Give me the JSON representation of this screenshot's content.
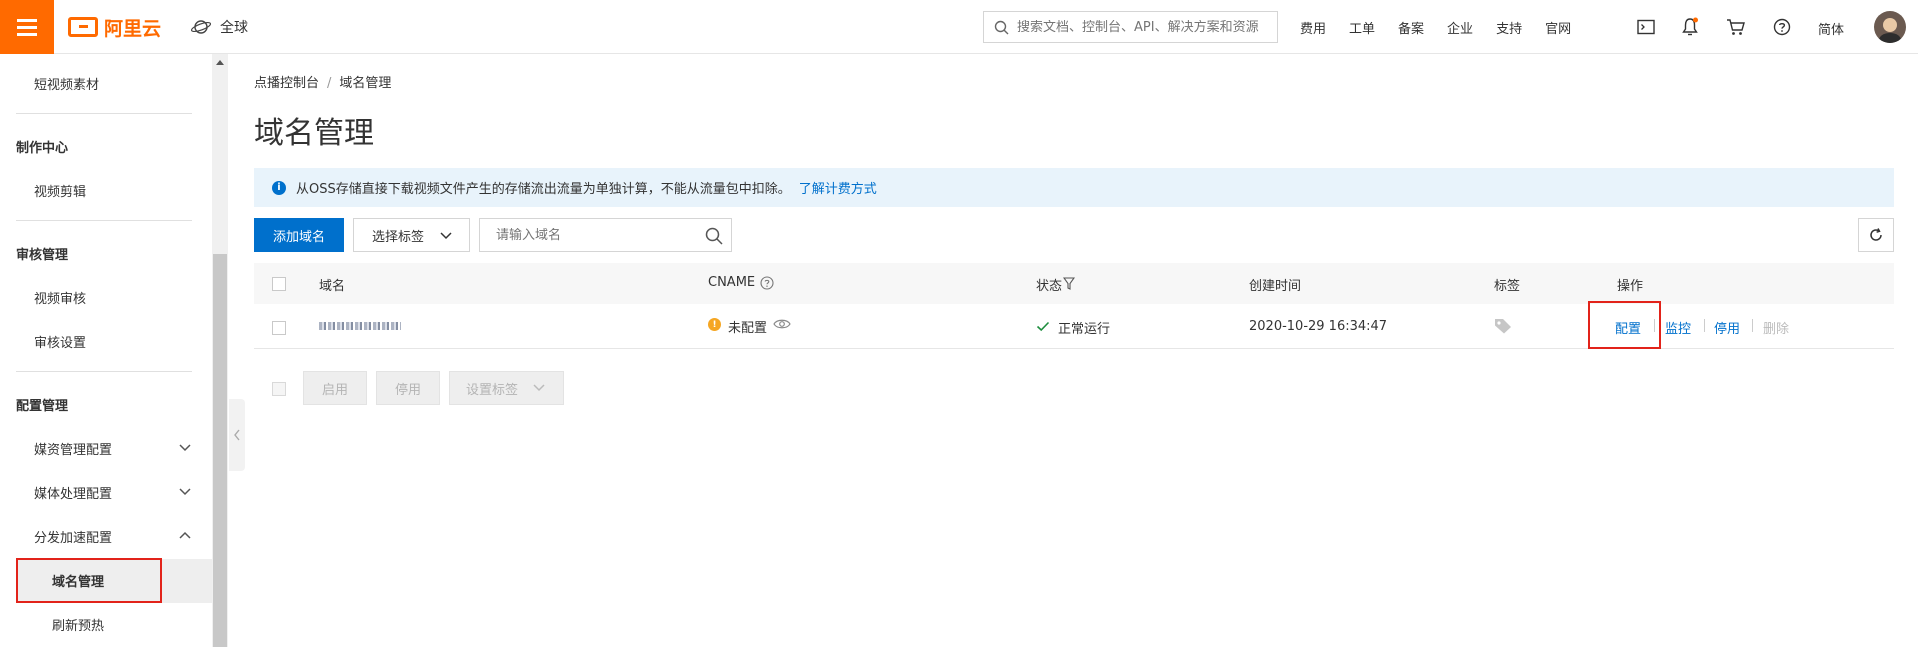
{
  "topbar": {
    "logo_text": "阿里云",
    "region": "全球",
    "search_placeholder": "搜索文档、控制台、API、解决方案和资源",
    "links": [
      "费用",
      "工单",
      "备案",
      "企业",
      "支持",
      "官网"
    ],
    "language": "简体"
  },
  "sidebar": {
    "items": {
      "short_video_material": "短视频素材",
      "section_production": "制作中心",
      "video_edit": "视频剪辑",
      "section_review": "审核管理",
      "video_review": "视频审核",
      "review_settings": "审核设置",
      "section_config": "配置管理",
      "media_asset_config": "媒资管理配置",
      "media_process_config": "媒体处理配置",
      "cdn_config": "分发加速配置",
      "domain_manage": "域名管理",
      "refresh_preheat": "刷新预热"
    }
  },
  "breadcrumb": {
    "root": "点播控制台",
    "separator": "/",
    "current": "域名管理"
  },
  "page": {
    "title": "域名管理"
  },
  "notice": {
    "text": "从OSS存储直接下载视频文件产生的存储流出流量为单独计算，不能从流量包中扣除。",
    "link": "了解计费方式"
  },
  "toolbar": {
    "add_domain": "添加域名",
    "select_tag": "选择标签",
    "domain_placeholder": "请输入域名"
  },
  "table": {
    "columns": {
      "domain": "域名",
      "cname": "CNAME",
      "status": "状态",
      "created": "创建时间",
      "tag": "标签",
      "action": "操作"
    },
    "rows": [
      {
        "cname_status": "未配置",
        "status": "正常运行",
        "created": "2020-10-29 16:34:47",
        "actions": {
          "config": "配置",
          "monitor": "监控",
          "disable": "停用",
          "delete": "删除"
        }
      }
    ]
  },
  "batch": {
    "enable": "启用",
    "disable": "停用",
    "set_tag": "设置标签"
  },
  "colors": {
    "brand": "#ff6a00",
    "primary": "#0070cc",
    "highlight_box": "#e2231a",
    "success": "#1e8e3e",
    "warning": "#f5a623"
  }
}
